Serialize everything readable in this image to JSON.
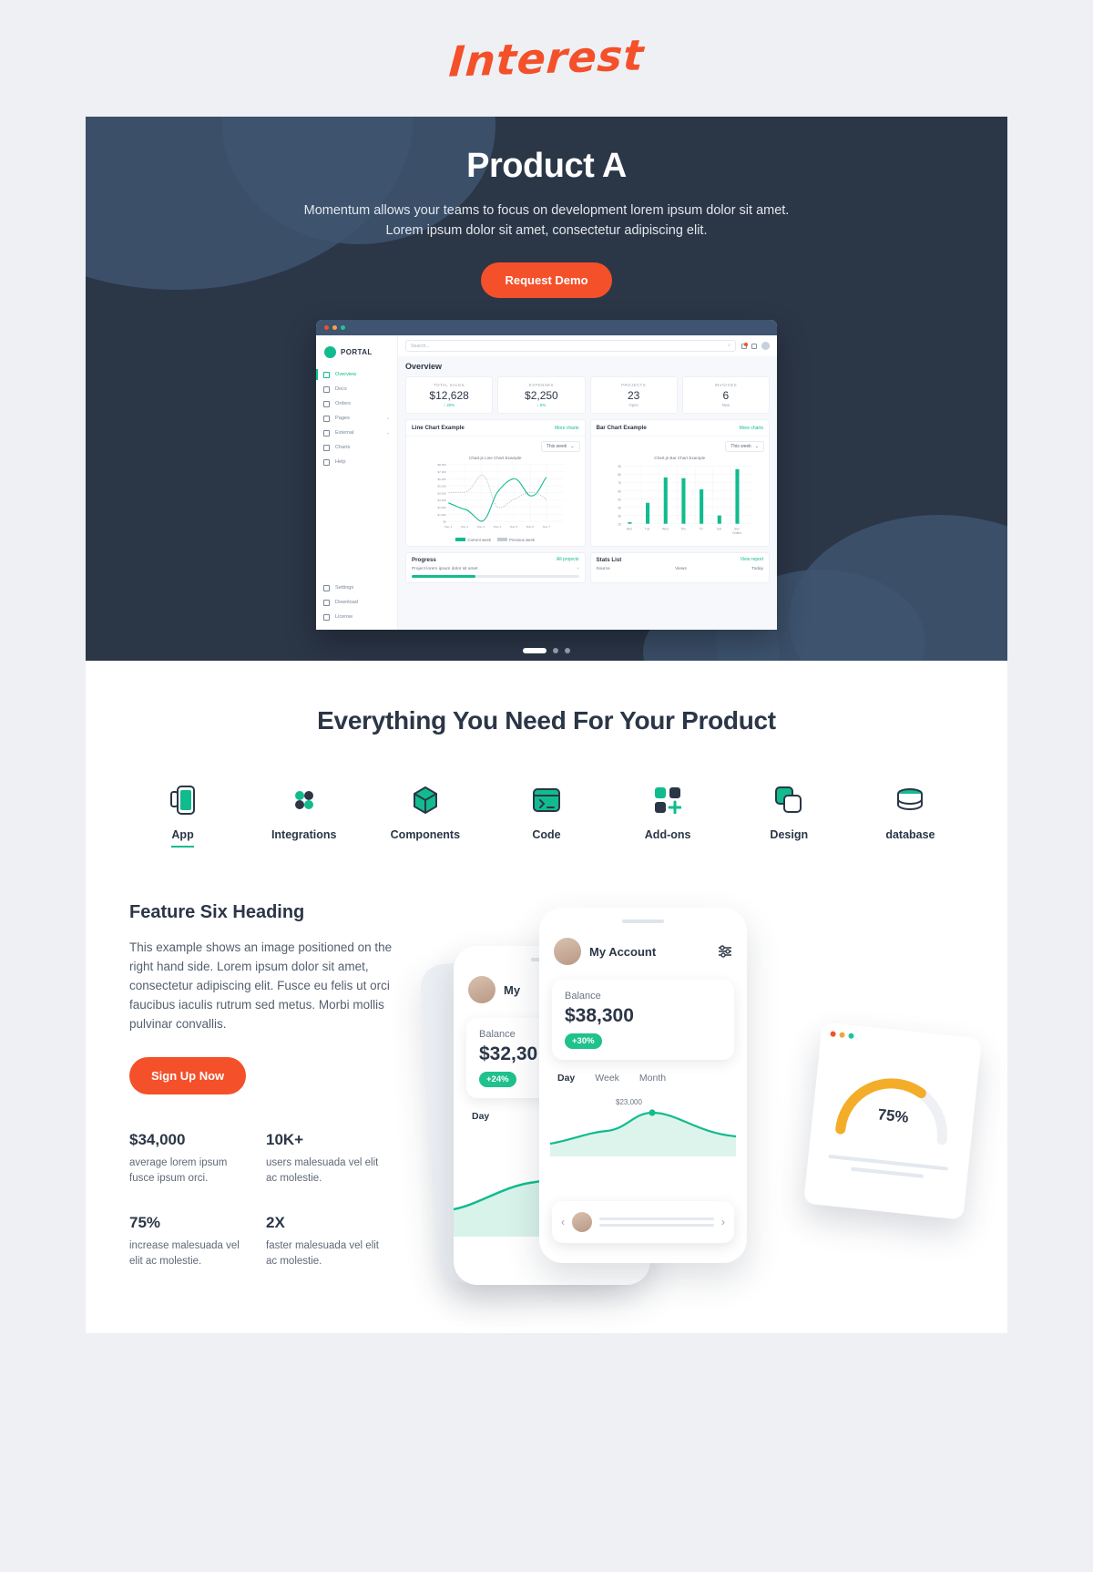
{
  "brand": {
    "name": "Interest"
  },
  "hero": {
    "title": "Product A",
    "subtitle_line1": "Momentum allows your teams to focus on development lorem ipsum dolor sit amet.",
    "subtitle_line2": "Lorem ipsum dolor sit amet, consectetur adipiscing elit.",
    "cta_label": "Request Demo",
    "accent_color": "#f4502a",
    "background_color": "#2b3647"
  },
  "dashboard": {
    "logo_label": "PORTAL",
    "search_placeholder": "Search...",
    "page_title": "Overview",
    "nav": [
      {
        "label": "Overview",
        "icon": "home-icon",
        "active": true,
        "chevron": false
      },
      {
        "label": "Docs",
        "icon": "folder-icon",
        "active": false,
        "chevron": false
      },
      {
        "label": "Orders",
        "icon": "orders-icon",
        "active": false,
        "chevron": false
      },
      {
        "label": "Pages",
        "icon": "pages-icon",
        "active": false,
        "chevron": true
      },
      {
        "label": "External",
        "icon": "external-icon",
        "active": false,
        "chevron": true
      },
      {
        "label": "Charts",
        "icon": "charts-icon",
        "active": false,
        "chevron": false
      },
      {
        "label": "Help",
        "icon": "help-icon",
        "active": false,
        "chevron": false
      }
    ],
    "nav_bottom": [
      {
        "label": "Settings",
        "icon": "gear-icon"
      },
      {
        "label": "Download",
        "icon": "download-icon"
      },
      {
        "label": "License",
        "icon": "license-icon"
      }
    ],
    "stats": [
      {
        "label": "TOTAL SALES",
        "value": "$12,628",
        "delta": "↑ 20%",
        "tone": "up"
      },
      {
        "label": "EXPENSES",
        "value": "$2,250",
        "delta": "↓ 5%",
        "tone": "up"
      },
      {
        "label": "PROJECTS",
        "value": "23",
        "delta": "Open",
        "tone": "gray"
      },
      {
        "label": "INVOICES",
        "value": "6",
        "delta": "New",
        "tone": "gray"
      }
    ],
    "line_card": {
      "title": "Line Chart Example",
      "action": "More charts",
      "range": "This week",
      "caption": "Chart.js Line Chart Example",
      "legend_current": "Current week",
      "legend_previous": "Previous week"
    },
    "bar_card": {
      "title": "Bar Chart Example",
      "action": "More charts",
      "range": "This week",
      "caption": "Chart.js Bar Chart Example",
      "axis_label": "Orders"
    },
    "progress_card": {
      "title": "Progress",
      "action": "All projects",
      "row": "Project lorem ipsum dolor sit amet"
    },
    "stats_card": {
      "title": "Stats List",
      "action": "View report",
      "col1": "Source",
      "col2": "Views",
      "col3": "Today"
    }
  },
  "chart_data": [
    {
      "type": "line",
      "title": "Chart.js Line Chart Example",
      "x": [
        "Day 1",
        "Day 2",
        "Day 3",
        "Day 4",
        "Day 5",
        "Day 6",
        "Day 7"
      ],
      "ylim": [
        0,
        8000
      ],
      "yticks": [
        "$0",
        "$1,000",
        "$2,000",
        "$3,000",
        "$4,000",
        "$5,000",
        "$6,000",
        "$7,000",
        "$8,000"
      ],
      "series": [
        {
          "name": "Current week",
          "values": [
            2600,
            1700,
            200,
            4900,
            6400,
            4000,
            6600
          ],
          "color": "#12bb8e"
        },
        {
          "name": "Previous week",
          "values": [
            4000,
            4200,
            6700,
            2200,
            3200,
            4100,
            3000
          ],
          "color": "#aab2c0"
        }
      ],
      "legend": "bottom",
      "grid": true
    },
    {
      "type": "bar",
      "title": "Chart.js Bar Chart Example",
      "categories": [
        "Mon",
        "Tue",
        "Wed",
        "Thu",
        "Fri",
        "Sat",
        "Sun"
      ],
      "values": [
        22,
        45,
        76,
        75,
        62,
        30,
        87
      ],
      "ylim": [
        20,
        90
      ],
      "yticks": [
        "20",
        "30",
        "40",
        "50",
        "60",
        "70",
        "80",
        "90"
      ],
      "xlabel": "Orders",
      "color": "#12bb8e",
      "grid": true
    }
  ],
  "carousel": {
    "slides": 3,
    "active": 0
  },
  "features": {
    "heading": "Everything You Need For Your Product",
    "tabs": [
      {
        "label": "App",
        "icon": "mobile-app-icon",
        "active": true
      },
      {
        "label": "Integrations",
        "icon": "puzzle-icon",
        "active": false
      },
      {
        "label": "Components",
        "icon": "cube-icon",
        "active": false
      },
      {
        "label": "Code",
        "icon": "terminal-icon",
        "active": false
      },
      {
        "label": "Add-ons",
        "icon": "addons-grid-icon",
        "active": false
      },
      {
        "label": "Design",
        "icon": "layers-icon",
        "active": false
      },
      {
        "label": "database",
        "icon": "database-icon",
        "active": false
      }
    ]
  },
  "feature_six": {
    "title": "Feature Six Heading",
    "body": "This example shows an image positioned on the right hand side. Lorem ipsum dolor sit amet, consectetur adipiscing elit. Fusce eu felis ut orci faucibus iaculis rutrum sed metus. Morbi mollis pulvinar convallis.",
    "cta_label": "Sign Up Now",
    "kpis": [
      {
        "value": "$34,000",
        "desc": "average lorem ipsum fusce ipsum orci."
      },
      {
        "value": "10K+",
        "desc": "users malesuada vel elit ac molestie."
      },
      {
        "value": "75%",
        "desc": "increase malesuada vel elit ac molestie."
      },
      {
        "value": "2X",
        "desc": "faster malesuada vel elit ac molestie."
      }
    ]
  },
  "phone_art": {
    "front": {
      "title": "My Account",
      "balance_label": "Balance",
      "balance_value": "$38,300",
      "badge": "+30%",
      "segments": [
        "Day",
        "Week",
        "Month"
      ],
      "active_segment": "Day",
      "point_label": "$23,000"
    },
    "mid": {
      "title": "My",
      "balance_label": "Balance",
      "balance_value": "$32,30",
      "badge": "+24%",
      "segment": "Day"
    },
    "widget": {
      "value": "75%"
    }
  }
}
